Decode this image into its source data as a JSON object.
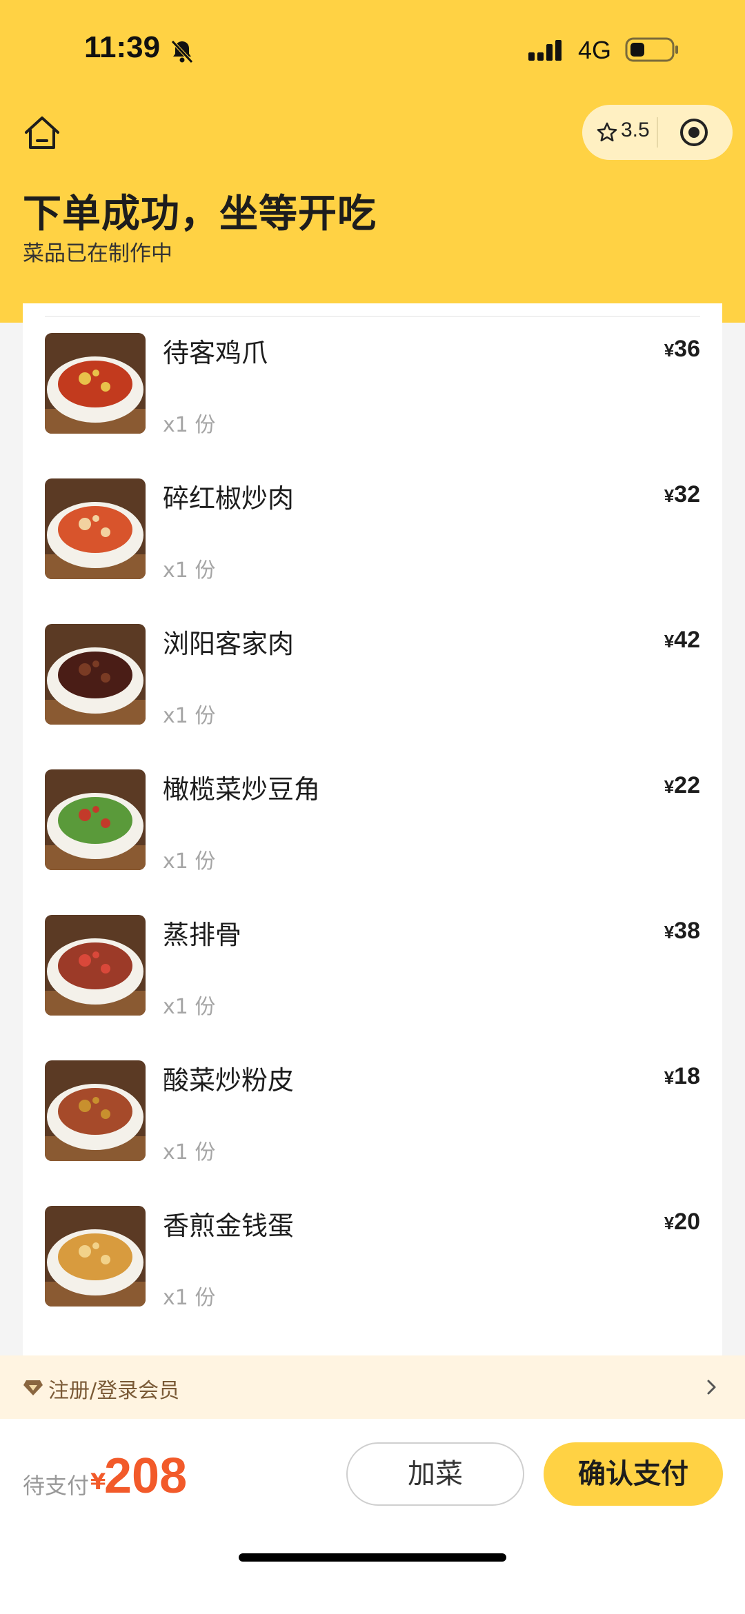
{
  "status_bar": {
    "time": "11:39",
    "network": "4G",
    "icons": [
      "bell-muted-icon",
      "signal-icon",
      "battery-icon"
    ]
  },
  "top_nav": {
    "home_icon": "home-icon",
    "rating": "3.5",
    "rating_icon": "star-icon",
    "target_icon": "target-icon"
  },
  "header": {
    "title": "下单成功，坐等开吃",
    "subtitle": "菜品已在制作中"
  },
  "order_items": [
    {
      "name": "待客鸡爪",
      "qty": "x1 份",
      "currency": "¥",
      "price": "36",
      "plate": "#c23a1e",
      "garnish": "#e8c24a"
    },
    {
      "name": "碎红椒炒肉",
      "qty": "x1 份",
      "currency": "¥",
      "price": "32",
      "plate": "#d8542c",
      "garnish": "#f2d2a0"
    },
    {
      "name": "浏阳客家肉",
      "qty": "x1 份",
      "currency": "¥",
      "price": "42",
      "plate": "#4a1d16",
      "garnish": "#7a3b24"
    },
    {
      "name": "橄榄菜炒豆角",
      "qty": "x1 份",
      "currency": "¥",
      "price": "22",
      "plate": "#5a9a3a",
      "garnish": "#c33a2a"
    },
    {
      "name": "蒸排骨",
      "qty": "x1 份",
      "currency": "¥",
      "price": "38",
      "plate": "#9c3a28",
      "garnish": "#d9483a"
    },
    {
      "name": "酸菜炒粉皮",
      "qty": "x1 份",
      "currency": "¥",
      "price": "18",
      "plate": "#a64a2a",
      "garnish": "#c8902e"
    },
    {
      "name": "香煎金钱蛋",
      "qty": "x1 份",
      "currency": "¥",
      "price": "20",
      "plate": "#d89b3e",
      "garnish": "#f2d28a"
    }
  ],
  "member": {
    "label": "注册/登录会员",
    "icon": "diamond-icon"
  },
  "footer": {
    "pay_label": "待支付",
    "currency": "¥",
    "amount": "208",
    "add_label": "加菜",
    "confirm_label": "确认支付"
  },
  "colors": {
    "brand_yellow": "#ffd244",
    "price_orange": "#f25a2a",
    "member_bg": "#fff4e1"
  }
}
